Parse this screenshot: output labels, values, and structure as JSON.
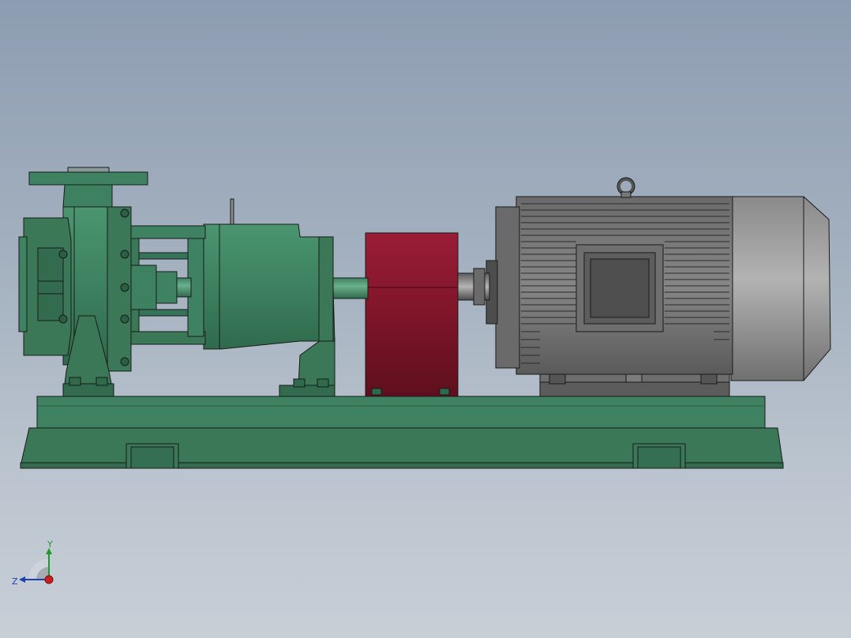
{
  "viewport": {
    "background_top": "#8d9db1",
    "background_bottom": "#c7ced6"
  },
  "model": {
    "pump_color": "#3f8563",
    "pump_dark": "#2a5e45",
    "coupling_guard_color": "#8a1a30",
    "motor_color": "#7a7a7a",
    "motor_dark": "#4a4a4a",
    "motor_fan_cover_color": "#9a9a9a",
    "baseplate_color": "#3b7a5a",
    "outline_color": "#1a1a1a"
  },
  "triad": {
    "y_label": "Y",
    "z_label": "Z",
    "y_color": "#1e9a2a",
    "z_color": "#1d3fa8",
    "x_color": "#c81e1e",
    "icons": [
      "view-orientation-triad-icon"
    ]
  }
}
